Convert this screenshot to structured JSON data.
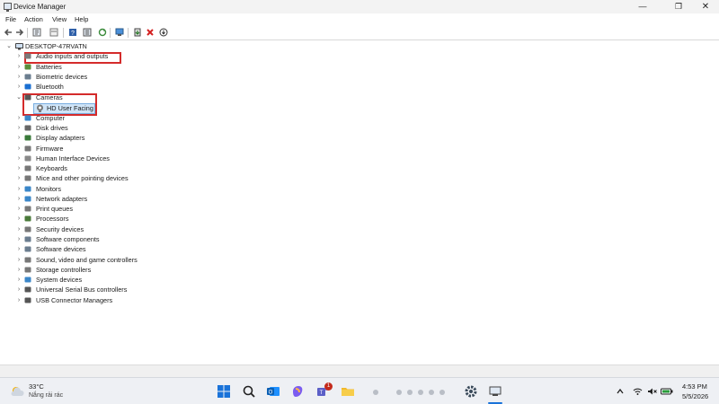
{
  "window": {
    "title": "Device Manager"
  },
  "menu": [
    "File",
    "Action",
    "View",
    "Help"
  ],
  "tree": {
    "root": "DESKTOP-47RVATN",
    "categories": [
      {
        "label": "Audio inputs and outputs",
        "icon": "speaker-icon",
        "color": "#7a7a7a"
      },
      {
        "label": "Batteries",
        "icon": "battery-icon",
        "color": "#5a8f3c"
      },
      {
        "label": "Biometric devices",
        "icon": "fingerprint-icon",
        "color": "#6b7d8f"
      },
      {
        "label": "Bluetooth",
        "icon": "bluetooth-icon",
        "color": "#1a6fd1"
      },
      {
        "label": "Cameras",
        "icon": "camera-icon",
        "color": "#555555"
      },
      {
        "label": "Computer",
        "icon": "computer-icon",
        "color": "#3a86c8"
      },
      {
        "label": "Disk drives",
        "icon": "disk-drive-icon",
        "color": "#666666"
      },
      {
        "label": "Display adapters",
        "icon": "display-adapter-icon",
        "color": "#3a7a3a"
      },
      {
        "label": "Firmware",
        "icon": "firmware-icon",
        "color": "#777777"
      },
      {
        "label": "Human Interface Devices",
        "icon": "hid-icon",
        "color": "#888888"
      },
      {
        "label": "Keyboards",
        "icon": "keyboard-icon",
        "color": "#777777"
      },
      {
        "label": "Mice and other pointing devices",
        "icon": "mouse-icon",
        "color": "#777777"
      },
      {
        "label": "Monitors",
        "icon": "monitor-icon",
        "color": "#3a86c8"
      },
      {
        "label": "Network adapters",
        "icon": "network-adapter-icon",
        "color": "#3a86c8"
      },
      {
        "label": "Print queues",
        "icon": "printer-icon",
        "color": "#777777"
      },
      {
        "label": "Processors",
        "icon": "processor-icon",
        "color": "#4a7a3a"
      },
      {
        "label": "Security devices",
        "icon": "security-device-icon",
        "color": "#777777"
      },
      {
        "label": "Software components",
        "icon": "software-component-icon",
        "color": "#6b7d8f"
      },
      {
        "label": "Software devices",
        "icon": "software-device-icon",
        "color": "#6b7d8f"
      },
      {
        "label": "Sound, video and game controllers",
        "icon": "sound-controller-icon",
        "color": "#777777"
      },
      {
        "label": "Storage controllers",
        "icon": "storage-controller-icon",
        "color": "#777777"
      },
      {
        "label": "System devices",
        "icon": "system-device-icon",
        "color": "#3a86c8"
      },
      {
        "label": "Universal Serial Bus controllers",
        "icon": "usb-icon",
        "color": "#555555"
      },
      {
        "label": "USB Connector Managers",
        "icon": "usb-connector-icon",
        "color": "#555555"
      }
    ],
    "camera_child": "HD User Facing",
    "highlight_color": "#d42b2b"
  },
  "taskbar": {
    "weather_temp": "33°C",
    "weather_desc": "Nắng rải rác",
    "time": "4:53 PM",
    "date": "5/5/2026",
    "teams_badge": "1"
  }
}
